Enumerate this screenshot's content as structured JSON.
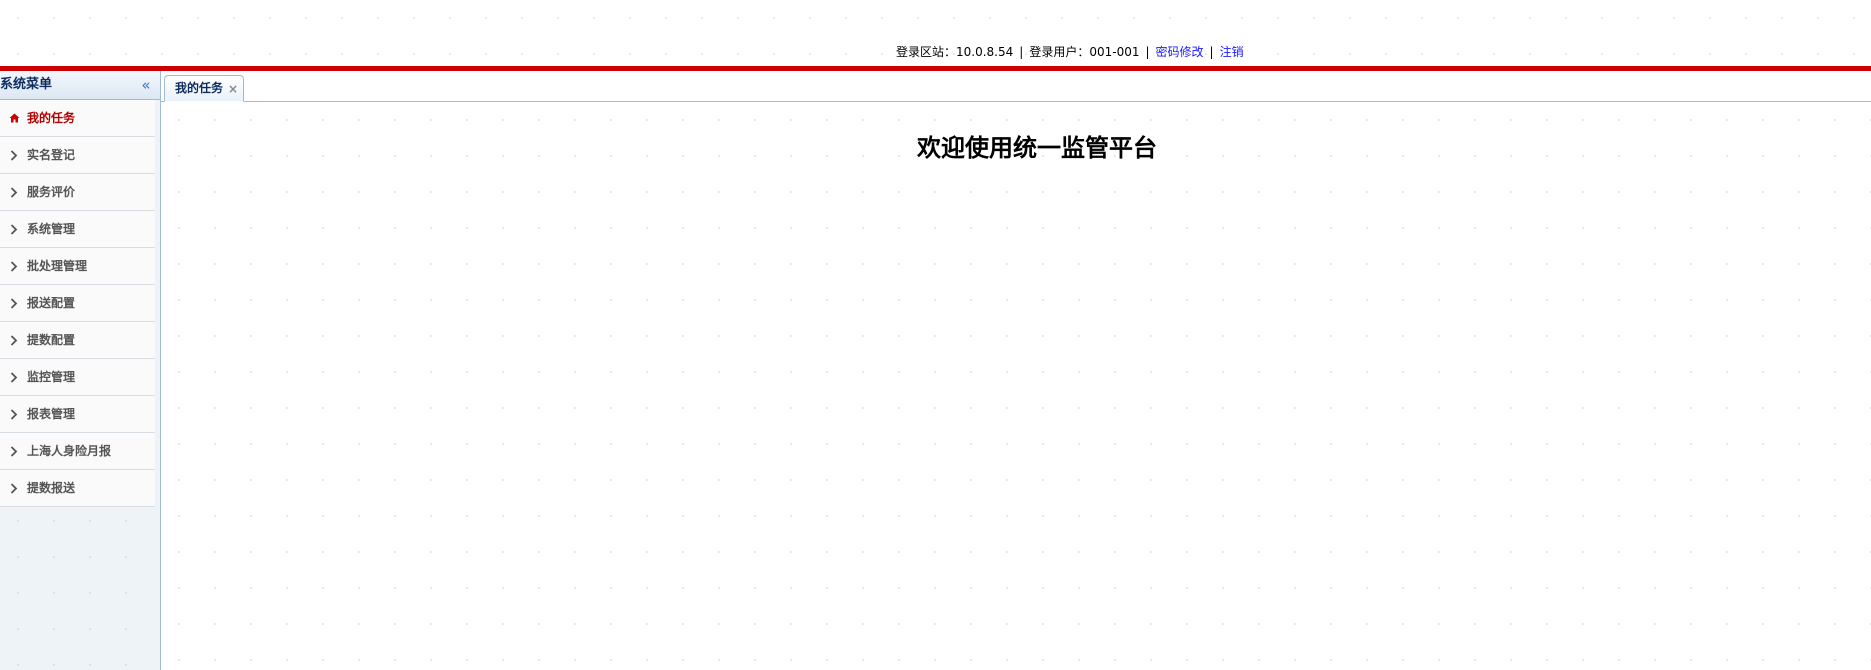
{
  "header": {
    "station_label": "登录区站：",
    "station_value": "10.0.8.54",
    "user_label": "登录用户：",
    "user_value": "001-001",
    "separator": "|",
    "change_password": "密码修改",
    "logout": "注销"
  },
  "sidebar": {
    "title": "系统菜单",
    "items": [
      {
        "label": "我的任务",
        "active": true,
        "icon": "home-icon"
      },
      {
        "label": "实名登记",
        "icon": "chevron-right-icon"
      },
      {
        "label": "服务评价",
        "icon": "chevron-right-icon"
      },
      {
        "label": "系统管理",
        "icon": "chevron-right-icon"
      },
      {
        "label": "批处理管理",
        "icon": "chevron-right-icon"
      },
      {
        "label": "报送配置",
        "icon": "chevron-right-icon"
      },
      {
        "label": "提数配置",
        "icon": "chevron-right-icon"
      },
      {
        "label": "监控管理",
        "icon": "chevron-right-icon"
      },
      {
        "label": "报表管理",
        "icon": "chevron-right-icon"
      },
      {
        "label": "上海人身险月报",
        "icon": "chevron-right-icon"
      },
      {
        "label": "提数报送",
        "icon": "chevron-right-icon"
      }
    ]
  },
  "tabs": [
    {
      "label": "我的任务",
      "close": "×"
    }
  ],
  "main": {
    "welcome": "欢迎使用统一监管平台"
  },
  "colors": {
    "brand_red": "#cc0000",
    "active_menu": "#b30000",
    "link": "#1a1aff",
    "border_blue": "#9fbbd6"
  }
}
